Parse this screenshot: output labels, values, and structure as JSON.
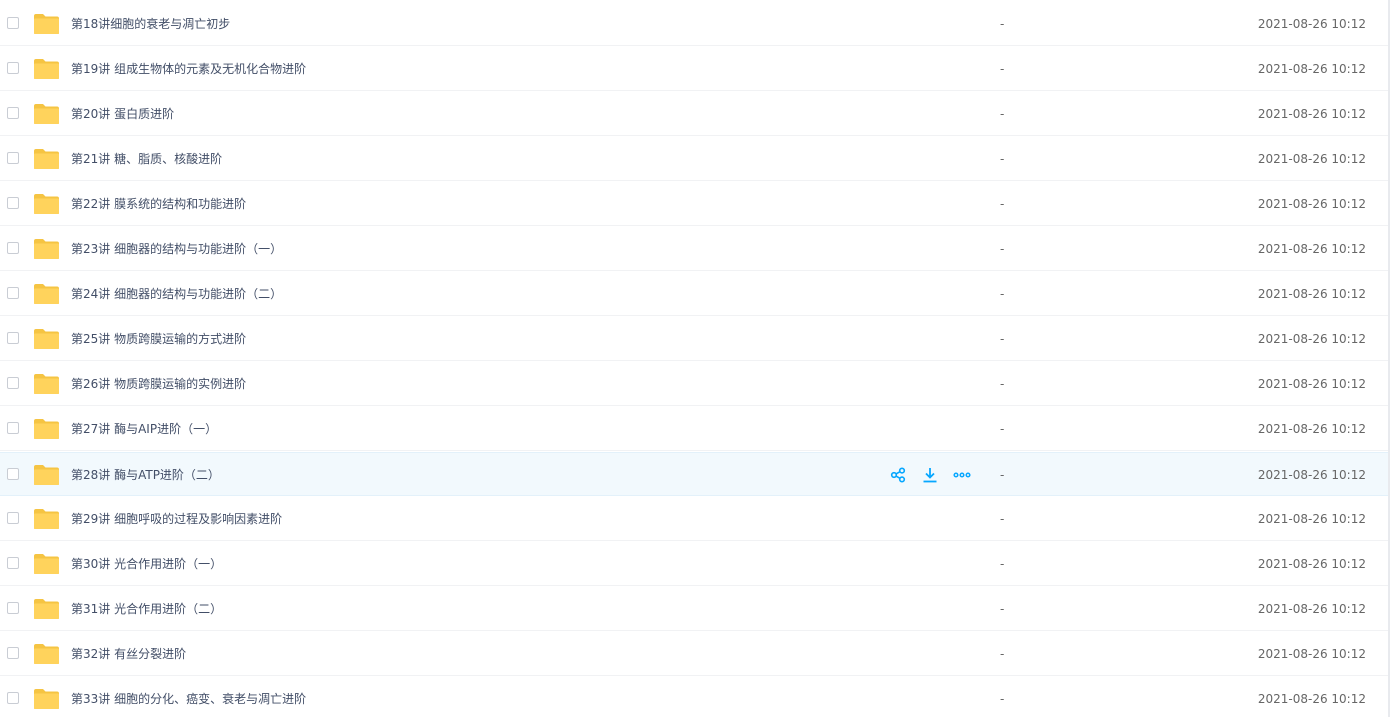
{
  "colors": {
    "folder": "#ffd35c",
    "folder_back": "#f5c443",
    "accent": "#06a7ff",
    "hover_row": "#f2f9fd"
  },
  "rows": [
    {
      "name": "第18讲细胞的衰老与凋亡初步",
      "size": "-",
      "date": "2021-08-26 10:12"
    },
    {
      "name": "第19讲 组成生物体的元素及无机化合物进阶",
      "size": "-",
      "date": "2021-08-26 10:12"
    },
    {
      "name": "第20讲 蛋白质进阶",
      "size": "-",
      "date": "2021-08-26 10:12"
    },
    {
      "name": "第21讲 糖、脂质、核酸进阶",
      "size": "-",
      "date": "2021-08-26 10:12"
    },
    {
      "name": "第22讲 膜系统的结构和功能进阶",
      "size": "-",
      "date": "2021-08-26 10:12"
    },
    {
      "name": "第23讲 细胞器的结构与功能进阶（一）",
      "size": "-",
      "date": "2021-08-26 10:12"
    },
    {
      "name": "第24讲 细胞器的结构与功能进阶（二）",
      "size": "-",
      "date": "2021-08-26 10:12"
    },
    {
      "name": "第25讲 物质跨膜运输的方式进阶",
      "size": "-",
      "date": "2021-08-26 10:12"
    },
    {
      "name": "第26讲 物质跨膜运输的实例进阶",
      "size": "-",
      "date": "2021-08-26 10:12"
    },
    {
      "name": "第27讲 酶与AIP进阶（一）",
      "size": "-",
      "date": "2021-08-26 10:12"
    },
    {
      "name": "第28讲 酶与ATP进阶（二）",
      "size": "-",
      "date": "2021-08-26 10:12"
    },
    {
      "name": "第29讲 细胞呼吸的过程及影响因素进阶",
      "size": "-",
      "date": "2021-08-26 10:12"
    },
    {
      "name": "第30讲 光合作用进阶（一）",
      "size": "-",
      "date": "2021-08-26 10:12"
    },
    {
      "name": "第31讲 光合作用进阶（二）",
      "size": "-",
      "date": "2021-08-26 10:12"
    },
    {
      "name": "第32讲 有丝分裂进阶",
      "size": "-",
      "date": "2021-08-26 10:12"
    },
    {
      "name": "第33讲 细胞的分化、癌变、衰老与凋亡进阶",
      "size": "-",
      "date": "2021-08-26 10:12"
    }
  ],
  "hover_actions": {
    "row_index": 10,
    "icons": [
      "share-icon",
      "download-icon",
      "more-icon"
    ]
  }
}
